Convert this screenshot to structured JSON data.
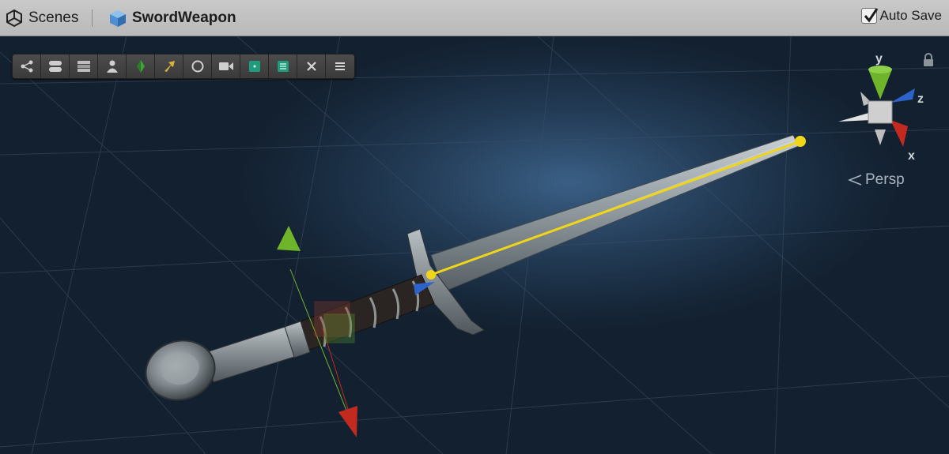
{
  "header": {
    "scenes_label": "Scenes",
    "prefab_name": "SwordWeapon",
    "autosave_label": "Auto Save",
    "autosave_checked": true
  },
  "toolbar": {
    "buttons": [
      {
        "icon": "share-nodes-icon"
      },
      {
        "icon": "toggle-pill-icon"
      },
      {
        "icon": "layers-icon"
      },
      {
        "icon": "person-icon"
      },
      {
        "icon": "green-gem-icon"
      },
      {
        "icon": "arrow-icon"
      },
      {
        "icon": "refresh-circle-icon"
      },
      {
        "icon": "camera-icon"
      },
      {
        "icon": "teal-square-icon"
      },
      {
        "icon": "teal-list-icon"
      },
      {
        "icon": "close-icon"
      },
      {
        "icon": "menu-icon"
      }
    ]
  },
  "gizmo": {
    "y_label": "y",
    "z_label": "z",
    "x_label": "x",
    "projection_label": "Persp"
  },
  "colors": {
    "header_bg": "#c4c4c4",
    "scene_bg": "#13202f",
    "axis_x": "#c22a1f",
    "axis_y": "#6fb52c",
    "axis_z": "#2d63c9",
    "handle_line": "#f1d518"
  }
}
